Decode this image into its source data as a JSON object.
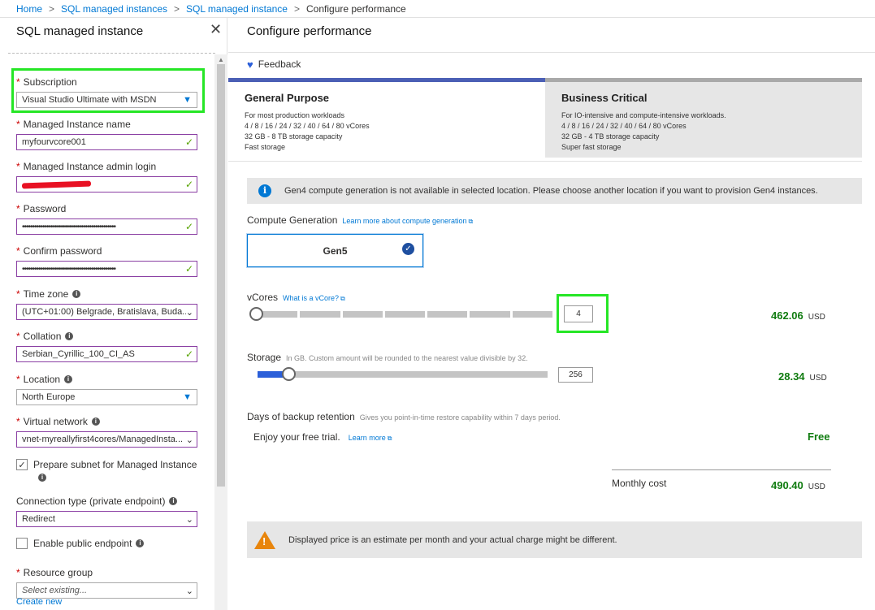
{
  "breadcrumb": {
    "items": [
      "Home",
      "SQL managed instances",
      "SQL managed instance"
    ],
    "current": "Configure performance"
  },
  "left": {
    "title": "SQL managed instance",
    "close": "✕",
    "fields": {
      "subscription": {
        "label": "Subscription",
        "value": "Visual Studio Ultimate with MSDN"
      },
      "name": {
        "label": "Managed Instance name",
        "value": "myfourvcore001"
      },
      "admin": {
        "label": "Managed Instance admin login"
      },
      "password": {
        "label": "Password",
        "value": "••••••••••••••••••••••••••••••••••••••••••••••"
      },
      "confirm": {
        "label": "Confirm password",
        "value": "••••••••••••••••••••••••••••••••••••••••••••••"
      },
      "timezone": {
        "label": "Time zone",
        "value": "(UTC+01:00) Belgrade, Bratislava, Buda..."
      },
      "collation": {
        "label": "Collation",
        "value": "Serbian_Cyrillic_100_CI_AS"
      },
      "location": {
        "label": "Location",
        "value": "North Europe"
      },
      "vnet": {
        "label": "Virtual network",
        "value": "vnet-myreallyfirst4cores/ManagedInsta..."
      },
      "subnet": {
        "label": "Prepare subnet for Managed Instance"
      },
      "conntype": {
        "label": "Connection type (private endpoint)",
        "value": "Redirect"
      },
      "public": {
        "label": "Enable public endpoint"
      },
      "rg": {
        "label": "Resource group",
        "value": "Select existing..."
      },
      "create_new": "Create new"
    }
  },
  "right": {
    "title": "Configure performance",
    "feedback": "Feedback",
    "tiers": {
      "gp": {
        "name": "General Purpose",
        "desc": "For most production workloads",
        "vcores": "4 / 8 / 16 / 24 / 32 / 40 / 64 / 80 vCores",
        "storage": "32 GB - 8 TB storage capacity",
        "speed": "Fast storage"
      },
      "bc": {
        "name": "Business Critical",
        "desc": "For IO-intensive and compute-intensive workloads.",
        "vcores": "4 / 8 / 16 / 24 / 32 / 40 / 64 / 80 vCores",
        "storage": "32 GB - 4 TB storage capacity",
        "speed": "Super fast storage"
      }
    },
    "info": "Gen4 compute generation is not available in selected location. Please choose another location if you want to provision Gen4 instances.",
    "compute": {
      "label": "Compute Generation",
      "link": "Learn more about compute generation",
      "gen": "Gen5"
    },
    "vcores": {
      "label": "vCores",
      "link": "What is a vCore?",
      "value": "4",
      "price": "462.06",
      "currency": "USD"
    },
    "storage": {
      "label": "Storage",
      "note": "In GB. Custom amount will be rounded to the nearest value divisible by 32.",
      "value": "256",
      "price": "28.34",
      "currency": "USD"
    },
    "backup": {
      "label": "Days of backup retention",
      "note": "Gives you point-in-time restore capability within 7 days period.",
      "trial": "Enjoy your free trial.",
      "link": "Learn more",
      "free": "Free"
    },
    "monthly": {
      "label": "Monthly cost",
      "price": "490.40",
      "currency": "USD"
    },
    "warning": "Displayed price is an estimate per month and your actual charge might be different."
  },
  "colors": {
    "accent": "#0078d4",
    "price": "#107c10",
    "highlight": "#26e626",
    "warning": "#e8850c"
  }
}
